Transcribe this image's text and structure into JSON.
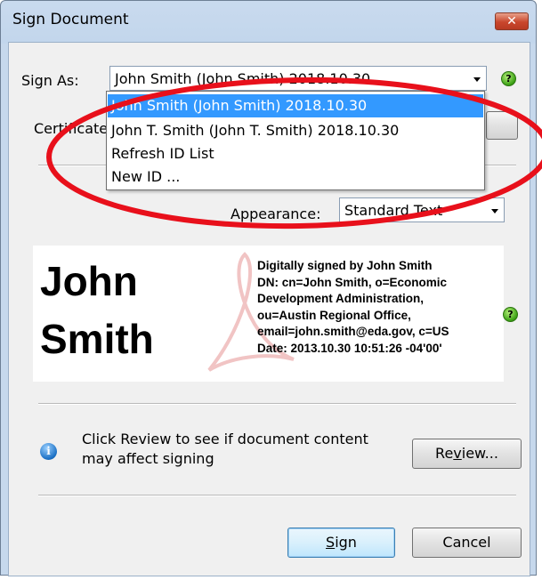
{
  "window": {
    "title": "Sign Document",
    "close_glyph": "✕"
  },
  "sign_as": {
    "label": "Sign As:",
    "value": "John Smith (John Smith) 2018.10.30",
    "options": [
      "John Smith (John Smith) 2018.10.30",
      "John T. Smith (John T. Smith) 2018.10.30",
      "Refresh ID List",
      "New ID ..."
    ],
    "selected_index": 0
  },
  "certificate": {
    "label": "Certificate"
  },
  "appearance": {
    "label": "Appearance:",
    "value": "Standard Text"
  },
  "preview": {
    "name_line1": "John",
    "name_line2": "Smith",
    "details": [
      "Digitally signed by John Smith",
      "DN: cn=John Smith, o=Economic",
      "Development Administration,",
      "ou=Austin Regional Office,",
      "email=john.smith@eda.gov, c=US",
      "Date: 2013.10.30 10:51:26 -04'00'"
    ]
  },
  "review": {
    "text_line1": "Click Review to see if document content",
    "text_line2": "may affect signing",
    "button": "Review..."
  },
  "buttons": {
    "sign": "Sign",
    "cancel": "Cancel"
  },
  "icons": {
    "help": "help-icon",
    "info": "info-icon"
  },
  "colors": {
    "selection": "#3399ff",
    "annotation_circle": "#e8101b",
    "close_button": "#c9462c"
  }
}
